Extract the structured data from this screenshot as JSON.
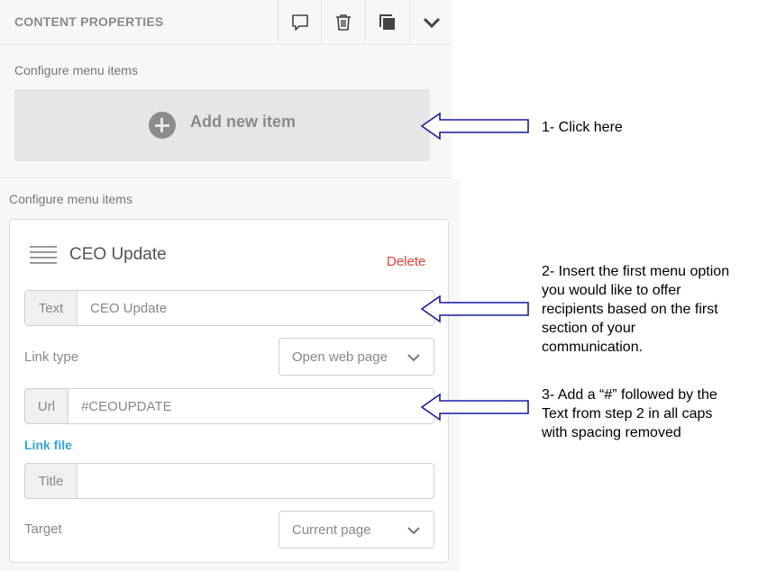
{
  "header": {
    "title": "CONTENT PROPERTIES",
    "icons": [
      "comment-icon",
      "trash-icon",
      "duplicate-icon",
      "chevron-down-icon"
    ]
  },
  "section1": {
    "label": "Configure menu items",
    "add_button_label": "Add new item"
  },
  "section2": {
    "label": "Configure menu items",
    "item": {
      "title": "CEO Update",
      "delete_label": "Delete",
      "text_field": {
        "label": "Text",
        "value": "CEO Update"
      },
      "link_type": {
        "label": "Link type",
        "value": "Open web page"
      },
      "url_field": {
        "label": "Url",
        "value": "#CEOUPDATE"
      },
      "link_file_label": "Link file",
      "title_field": {
        "label": "Title",
        "value": ""
      },
      "target": {
        "label": "Target",
        "value": "Current page"
      }
    }
  },
  "annotations": {
    "step1": "1- Click here",
    "step2_lines": [
      "2- Insert the first menu option",
      "you would like to offer",
      "recipients based on the first",
      "section of your",
      "communication."
    ],
    "step3_lines": [
      "3- Add a “#” followed by the",
      "Text from step 2 in all caps",
      "with spacing removed"
    ]
  },
  "colors": {
    "panel_bg": "#f7f7f7",
    "delete": "#e0443a",
    "link": "#2fa6d8",
    "arrow_stroke": "#1a1aa6"
  }
}
